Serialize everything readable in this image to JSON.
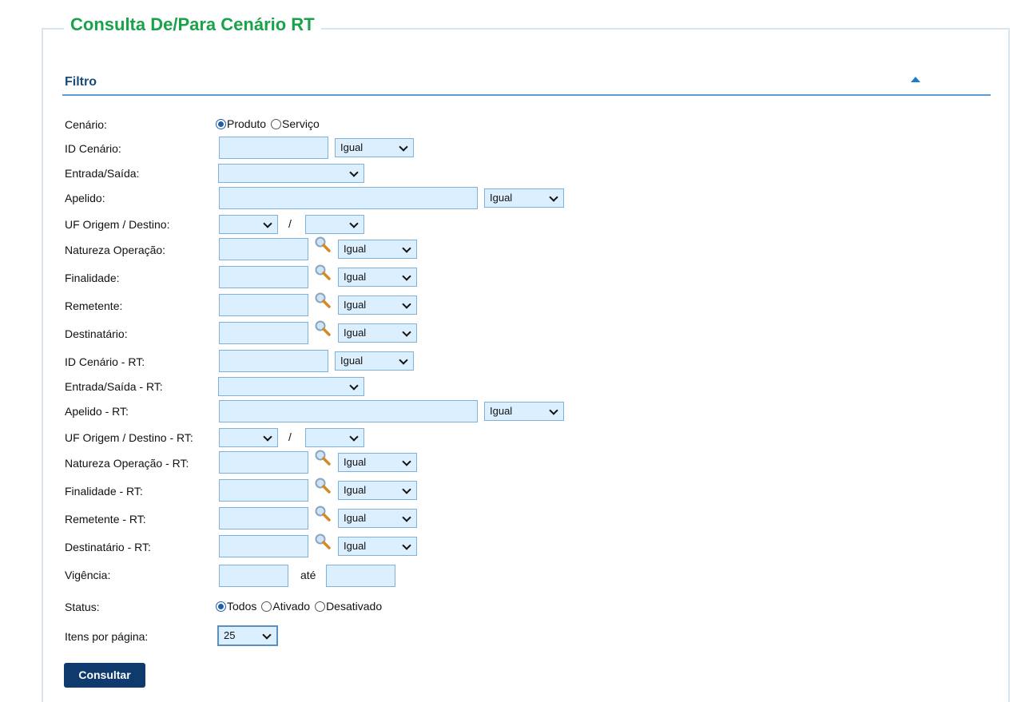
{
  "page": {
    "title": "Consulta De/Para Cenário RT"
  },
  "filter": {
    "title": "Filtro"
  },
  "colors": {
    "title": "#19a24a",
    "section": "#164b7a",
    "input_bg": "#dcefff",
    "button": "#0e3a6e"
  },
  "icons": {
    "collapse": "triangle-up-icon",
    "lookup": "magnifier-icon"
  },
  "fields": {
    "cenario": {
      "label": "Cenário:",
      "options": [
        "Produto",
        "Serviço"
      ],
      "selected": "Produto"
    },
    "id_cenario": {
      "label": "ID Cenário:",
      "value": "",
      "operator": "Igual"
    },
    "entrada_saida": {
      "label": "Entrada/Saída:",
      "value": ""
    },
    "apelido": {
      "label": "Apelido:",
      "value": "",
      "operator": "Igual"
    },
    "uf": {
      "label": "UF Origem / Destino:",
      "origem": "",
      "destino": "",
      "separator": "/"
    },
    "natureza": {
      "label": "Natureza Operação:",
      "value": "",
      "operator": "Igual"
    },
    "finalidade": {
      "label": "Finalidade:",
      "value": "",
      "operator": "Igual"
    },
    "remetente": {
      "label": "Remetente:",
      "value": "",
      "operator": "Igual"
    },
    "destinatario": {
      "label": "Destinatário:",
      "value": "",
      "operator": "Igual"
    },
    "id_cenario_rt": {
      "label": "ID Cenário - RT:",
      "value": "",
      "operator": "Igual"
    },
    "entrada_saida_rt": {
      "label": "Entrada/Saída - RT:",
      "value": ""
    },
    "apelido_rt": {
      "label": "Apelido - RT:",
      "value": "",
      "operator": "Igual"
    },
    "uf_rt": {
      "label": "UF Origem / Destino - RT:",
      "origem": "",
      "destino": "",
      "separator": "/"
    },
    "natureza_rt": {
      "label": "Natureza Operação - RT:",
      "value": "",
      "operator": "Igual"
    },
    "finalidade_rt": {
      "label": "Finalidade - RT:",
      "value": "",
      "operator": "Igual"
    },
    "remetente_rt": {
      "label": "Remetente - RT:",
      "value": "",
      "operator": "Igual"
    },
    "destinatario_rt": {
      "label": "Destinatário - RT:",
      "value": "",
      "operator": "Igual"
    },
    "vigencia": {
      "label": "Vigência:",
      "from": "",
      "to_label": "até",
      "to": ""
    },
    "status": {
      "label": "Status:",
      "options": [
        "Todos",
        "Ativado",
        "Desativado"
      ],
      "selected": "Todos"
    },
    "itens": {
      "label": "Itens por página:",
      "value": "25"
    }
  },
  "actions": {
    "consultar": "Consultar"
  }
}
